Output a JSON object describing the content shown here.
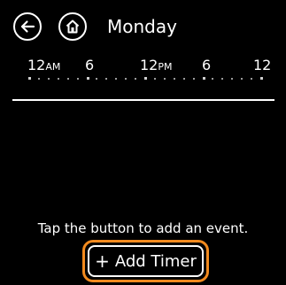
{
  "header": {
    "back_icon": "arrow-left-icon",
    "home_icon": "home-icon",
    "title": "Monday"
  },
  "timeline": {
    "ticks": [
      {
        "value": "12",
        "suffix": "AM"
      },
      {
        "value": "6",
        "suffix": ""
      },
      {
        "value": "12",
        "suffix": "PM"
      },
      {
        "value": "6",
        "suffix": ""
      },
      {
        "value": "12",
        "suffix": ""
      }
    ]
  },
  "empty_state": {
    "hint": "Tap the button to add an event."
  },
  "add_timer": {
    "plus_symbol": "+",
    "label": "Add Timer",
    "highlight_color": "#f28a1e"
  }
}
